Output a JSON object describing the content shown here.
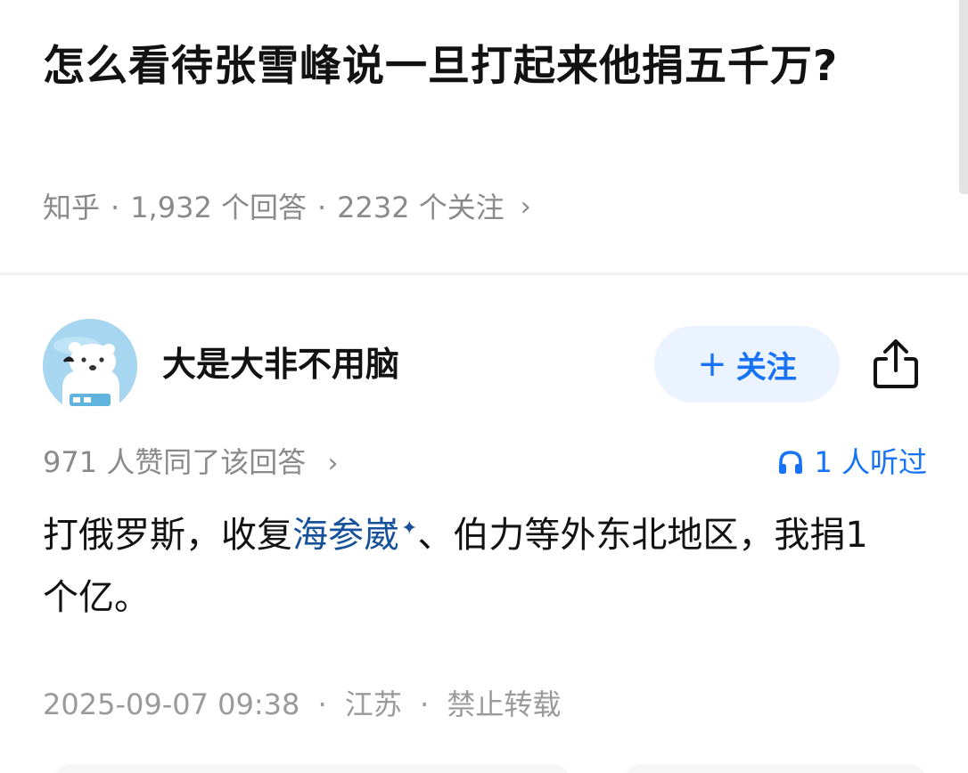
{
  "question": {
    "title": "怎么看待张雪峰说一旦打起来他捐五千万?",
    "source": "知乎",
    "answer_count": "1,932 个回答",
    "follower_count": "2232 个关注",
    "separator": "·",
    "chevron": "›"
  },
  "author": {
    "name": "大是大非不用脑",
    "avatar_icon": "polar-bear-avatar-icon",
    "follow_plus": "+",
    "follow_label": "关注",
    "share_icon": "share-icon"
  },
  "answer": {
    "likes_text": "971 人赞同了该回答",
    "listen_text": "1 人听过",
    "listen_icon": "headphones-icon",
    "body_before": "打俄罗斯，收复",
    "body_keyword": "海参崴",
    "body_keyword_mark": "✦",
    "body_after": "、伯力等外东北地区，我捐1个亿。",
    "date": "2025-09-07 09:38",
    "location": "江苏",
    "copyright": "禁止转载"
  },
  "colors": {
    "accent_blue": "#1772f6",
    "follow_bg": "#ebf3ff",
    "link_blue": "#175199",
    "meta_gray": "#8a8a8a"
  }
}
